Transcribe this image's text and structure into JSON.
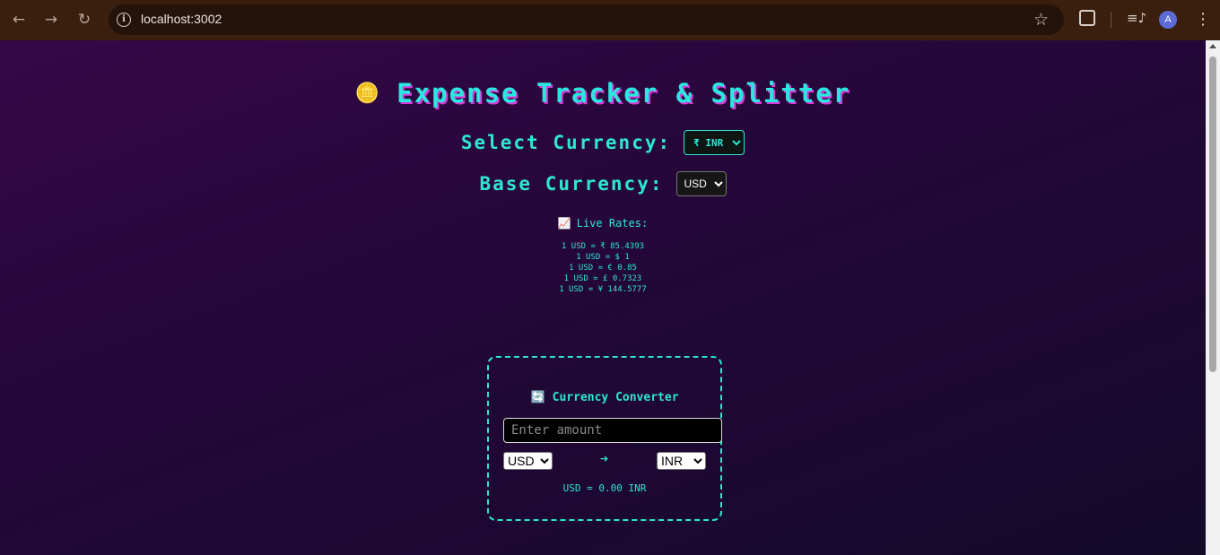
{
  "browser": {
    "back_icon": "arrow-left-icon",
    "forward_icon": "arrow-right-icon",
    "reload_icon": "reload-icon",
    "url": "localhost:3002",
    "avatar_letter": "A"
  },
  "app": {
    "title_icon": "🪙",
    "title": "Expense Tracker & Splitter",
    "select_currency_label": "Select Currency:",
    "select_currency_value": "₹ INR",
    "base_currency_label": "Base Currency:",
    "base_currency_value": "USD",
    "live_rates_icon": "📈",
    "live_rates_label": "Live Rates:",
    "rates": [
      "1 USD = ₹ 85.4393",
      "1 USD = $ 1",
      "1 USD = € 0.85",
      "1 USD = £ 0.7323",
      "1 USD = ¥ 144.5777"
    ]
  },
  "converter": {
    "icon": "🔄",
    "title": "Currency Converter",
    "amount_placeholder": "Enter amount",
    "from_currency": "USD",
    "arrow": "➔",
    "to_currency": "INR",
    "result": "USD = 0.00 INR"
  },
  "colors": {
    "accent": "#2fe7d0",
    "title_shadow": "#d83bd8",
    "background_top": "#350747",
    "background_bottom": "#130a2a"
  }
}
